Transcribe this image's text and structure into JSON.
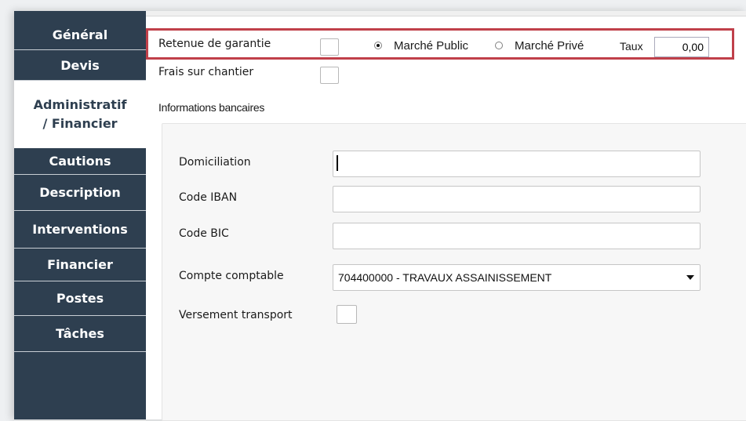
{
  "sidebar": {
    "tabs": [
      {
        "label": "Général"
      },
      {
        "label": "Devis"
      },
      {
        "label_line1": "Administratif",
        "label_line2": "/ Financier",
        "active": true
      },
      {
        "label": "Cautions"
      },
      {
        "label": "Description"
      },
      {
        "label": "Interventions"
      },
      {
        "label": "Financier"
      },
      {
        "label": "Postes"
      },
      {
        "label": "Tâches"
      }
    ]
  },
  "main": {
    "retenue_label": "Retenue de garantie",
    "radio_public": "Marché Public",
    "radio_prive": "Marché Privé",
    "taux_label": "Taux",
    "taux_value": "0,00",
    "frais_label": "Frais sur chantier",
    "banking_title": "Informations bancaires",
    "domiciliation_label": "Domiciliation",
    "domiciliation_value": "",
    "iban_label": "Code IBAN",
    "iban_value": "",
    "bic_label": "Code BIC",
    "bic_value": "",
    "compte_label": "Compte comptable",
    "compte_value": "704400000 - TRAVAUX ASSAINISSEMENT",
    "versement_label": "Versement transport"
  },
  "colors": {
    "sidebar_bg": "#2e3f50",
    "highlight": "#c0404a"
  }
}
